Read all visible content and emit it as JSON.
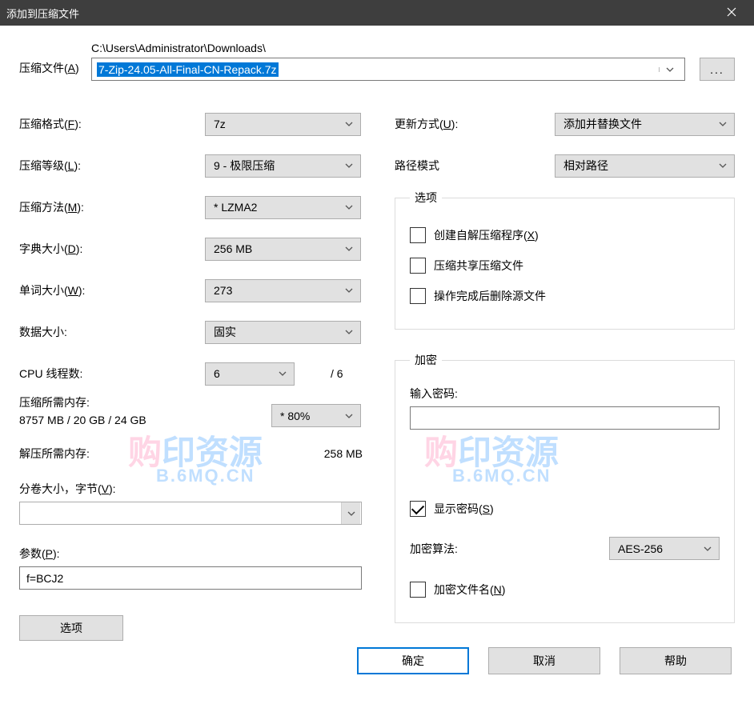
{
  "title": "添加到压缩文件",
  "archive": {
    "label": "压缩文件(A)",
    "path": "C:\\Users\\Administrator\\Downloads\\",
    "filename": "7-Zip-24.05-All-Final-CN-Repack.7z"
  },
  "browse_btn": "...",
  "left": {
    "format_label": "压缩格式(F):",
    "format_value": "7z",
    "level_label": "压缩等级(L):",
    "level_value": "9 - 极限压缩",
    "method_label": "压缩方法(M):",
    "method_value": "* LZMA2",
    "dict_label": "字典大小(D):",
    "dict_value": "256 MB",
    "word_label": "单词大小(W):",
    "word_value": "273",
    "block_label": "数据大小:",
    "block_value": "固实",
    "threads_label": "CPU 线程数:",
    "threads_value": "6",
    "threads_total": "/ 6",
    "mem_compress_label": "压缩所需内存:",
    "mem_compress_value": "8757 MB / 20 GB / 24 GB",
    "mem_pct_value": "* 80%",
    "mem_decompress_label": "解压所需内存:",
    "mem_decompress_value": "258 MB",
    "volume_label": "分卷大小，字节(V):",
    "params_label": "参数(P):",
    "params_value": "f=BCJ2",
    "option_btn": "选项"
  },
  "right": {
    "update_label": "更新方式(U):",
    "update_value": "添加并替换文件",
    "pathmode_label": "路径模式",
    "pathmode_value": "相对路径",
    "options_legend": "选项",
    "opt_sfx": "创建自解压缩程序(X)",
    "opt_shared": "压缩共享压缩文件",
    "opt_delete": "操作完成后删除源文件",
    "enc_legend": "加密",
    "enc_pw_label": "输入密码:",
    "enc_show_pw": "显示密码(S)",
    "enc_method_label": "加密算法:",
    "enc_method_value": "AES-256",
    "enc_names": "加密文件名(N)"
  },
  "buttons": {
    "ok": "确定",
    "cancel": "取消",
    "help": "帮助"
  },
  "watermark": {
    "main": "购印资源",
    "sub": "B.6MQ.CN"
  }
}
